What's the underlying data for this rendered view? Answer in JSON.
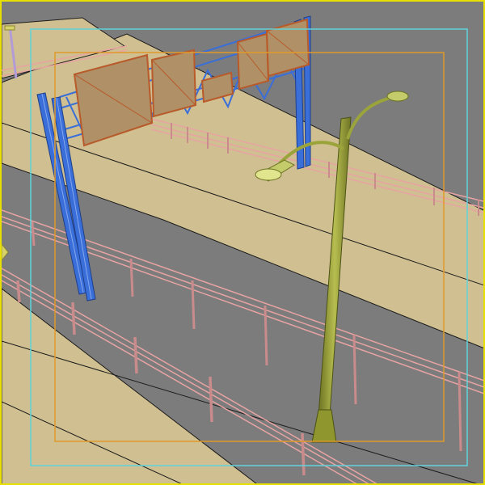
{
  "viewport": {
    "label": "",
    "active_border_color": "#e8e000",
    "background_color": "#7c7c7c"
  },
  "frames": {
    "safe_frame_color": "#5fd3dc",
    "action_safe_color": "#e09a2a"
  },
  "scene": {
    "objects": [
      {
        "name": "gantry-sign-structure",
        "color": "#3a6ed8",
        "icon": "truss-icon"
      },
      {
        "name": "highway-sign-panels",
        "color": "#b6773e",
        "icon": "sign-panel-icon"
      },
      {
        "name": "street-lamp",
        "color": "#9aa43a",
        "icon": "lamp-icon"
      },
      {
        "name": "guardrails",
        "color": "#e8a3a3",
        "icon": "guardrail-icon"
      },
      {
        "name": "road-surface",
        "color": "#cfbf91",
        "icon": "road-icon"
      },
      {
        "name": "far-lamp",
        "color": "#b39bd8",
        "icon": "lamp-icon"
      }
    ]
  }
}
